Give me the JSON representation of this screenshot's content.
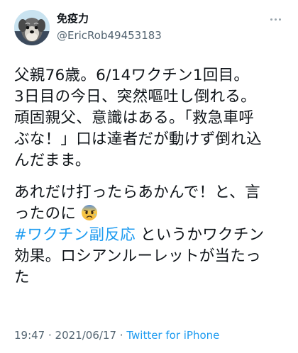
{
  "user": {
    "display_name": "免疫力",
    "handle": "@EricRob49453183",
    "avatar": "dog-avatar"
  },
  "tweet": {
    "paragraph1": [
      "父親76歳。6/14ワクチン1回目。",
      "3日目の今日、突然嘔吐し倒れる。",
      "頑固親父、意識はある。「救急車呼",
      "ぶな！」口は達者だが動けず倒れ込",
      "んだまま。"
    ],
    "paragraph2": {
      "line1": "あれだけ打ったらあかんで！と、言",
      "line2_text": "ったのに",
      "line2_emoji": "fearful-face-emoji",
      "hashtag": "#ワクチン副反応",
      "after_hashtag": " というかワクチン",
      "line4": "効果。ロシアンルーレットが当たっ",
      "line5": "た"
    }
  },
  "meta": {
    "time": "19:47",
    "separator": " · ",
    "date": "2021/06/17",
    "source": "Twitter for iPhone"
  },
  "colors": {
    "link": "#1d9bf0",
    "text": "#0f1419",
    "secondary": "#536471"
  },
  "icons": [
    "more-options-icon",
    "fearful-face-emoji"
  ]
}
